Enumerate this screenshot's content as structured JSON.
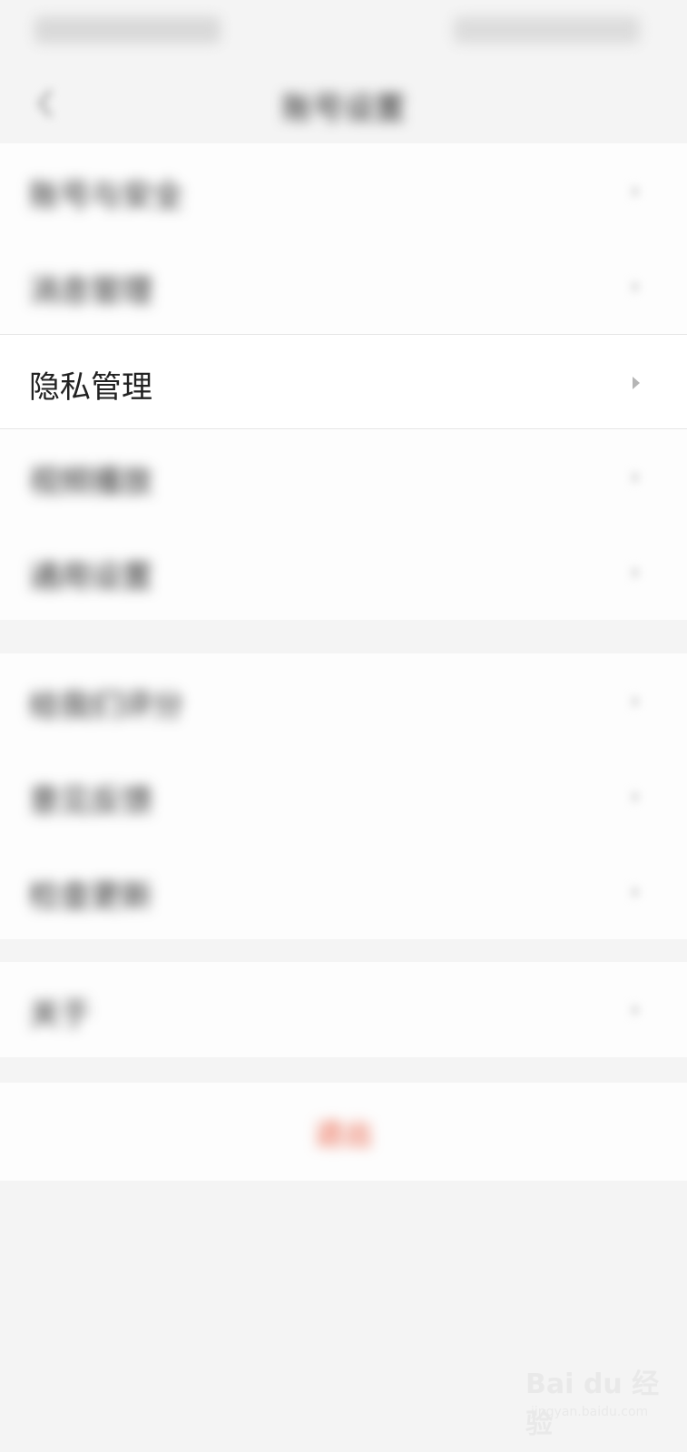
{
  "status_bar": {
    "left_text": "",
    "right_text": ""
  },
  "nav": {
    "title": "账号设置"
  },
  "groups": [
    {
      "items": [
        {
          "label": "账号与安全",
          "focused": false
        },
        {
          "label": "消息管理",
          "focused": false
        },
        {
          "label": "隐私管理",
          "focused": true
        },
        {
          "label": "视频播放",
          "focused": false
        },
        {
          "label": "通用设置",
          "focused": false
        }
      ]
    },
    {
      "items": [
        {
          "label": "给我们评分",
          "focused": false
        },
        {
          "label": "意见反馈",
          "focused": false
        },
        {
          "label": "检查更新",
          "focused": false
        }
      ]
    },
    {
      "items": [
        {
          "label": "关于",
          "focused": false
        }
      ]
    }
  ],
  "logout": {
    "label": "退出"
  },
  "watermark": {
    "brand": "Bai du 经验",
    "url": "jingyan.baidu.com"
  },
  "colors": {
    "accent": "#e8563a",
    "page_bg": "#f4f4f4",
    "row_bg": "#fdfdfd"
  }
}
